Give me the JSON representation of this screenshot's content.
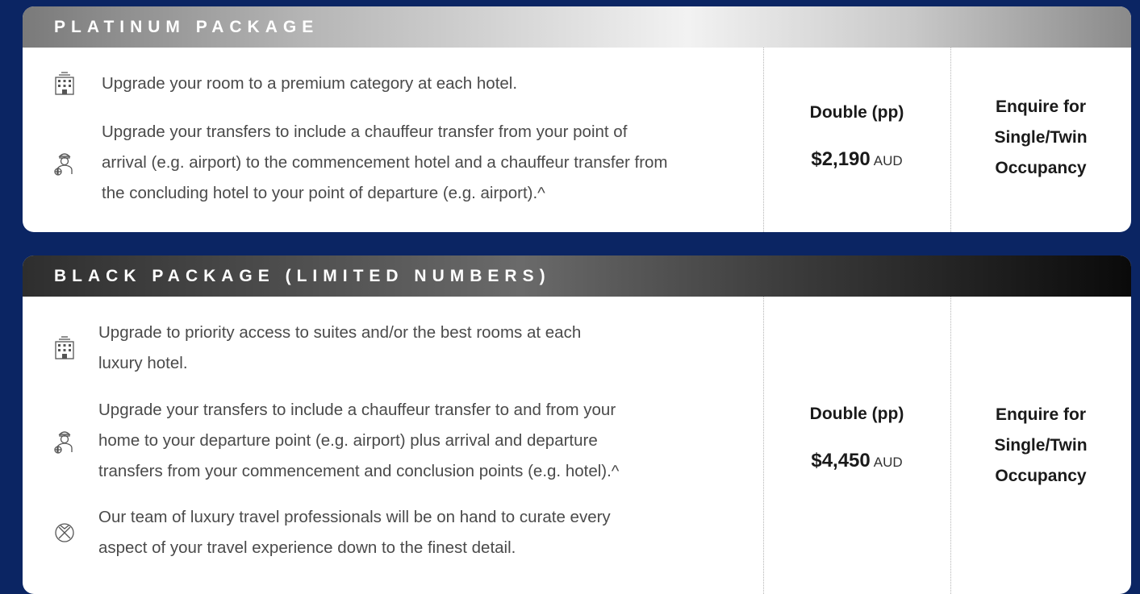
{
  "platinum": {
    "title": "PLATINUM PACKAGE",
    "features": [
      {
        "icon": "hotel-icon",
        "lines": [
          "Upgrade your room to a premium category at each hotel."
        ]
      },
      {
        "icon": "chauffeur-icon",
        "lines": [
          "Upgrade your transfers to include a chauffeur transfer from your point of",
          "arrival (e.g. airport) to the commencement hotel and a chauffeur transfer from",
          "the concluding hotel to your point of departure (e.g. airport).^"
        ]
      }
    ],
    "price_label": "Double (pp)",
    "price": "$2,190",
    "currency": "AUD",
    "enquire": [
      "Enquire for",
      "Single/Twin",
      "Occupancy"
    ]
  },
  "black": {
    "title": "BLACK PACKAGE (LIMITED NUMBERS)",
    "features": [
      {
        "icon": "hotel-icon",
        "lines": [
          "Upgrade to priority access to suites and/or the best rooms at each",
          "luxury hotel."
        ]
      },
      {
        "icon": "chauffeur-icon",
        "lines": [
          "Upgrade your transfers to include a chauffeur transfer to and from your",
          "home to your departure point (e.g. airport) plus arrival and departure",
          "transfers from your commencement and conclusion points (e.g. hotel).^"
        ]
      },
      {
        "icon": "concierge-icon",
        "lines": [
          "Our team of luxury travel professionals will be on hand to curate every",
          "aspect of your travel experience down to the finest detail."
        ]
      }
    ],
    "price_label": "Double (pp)",
    "price": "$4,450",
    "currency": "AUD",
    "enquire": [
      "Enquire for",
      "Single/Twin",
      "Occupancy"
    ]
  }
}
